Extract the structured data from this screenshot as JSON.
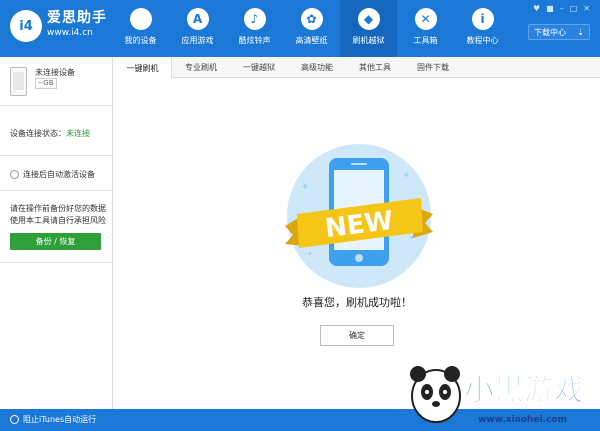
{
  "app": {
    "logo_text": "i4",
    "brand_name": "爱思助手",
    "brand_url": "www.i4.cn"
  },
  "nav": [
    {
      "label": "我的设备",
      "icon": "apple-icon",
      "glyph": ""
    },
    {
      "label": "应用游戏",
      "icon": "appstore-icon",
      "glyph": "A"
    },
    {
      "label": "酷炫铃声",
      "icon": "bell-icon",
      "glyph": "♪"
    },
    {
      "label": "高清壁纸",
      "icon": "flower-icon",
      "glyph": "✿"
    },
    {
      "label": "刷机越狱",
      "icon": "dropbox-icon",
      "glyph": "◆"
    },
    {
      "label": "工具箱",
      "icon": "tools-icon",
      "glyph": "✕"
    },
    {
      "label": "教程中心",
      "icon": "info-icon",
      "glyph": "i"
    }
  ],
  "window_controls": [
    "♥",
    "■",
    "–",
    "□",
    "✕"
  ],
  "download_center": {
    "label": "下载中心",
    "icon": "download-icon",
    "glyph": "⇣"
  },
  "sidebar": {
    "device_name": "未连接设备",
    "device_capacity": "--GB",
    "connection_label": "设备连接状态：",
    "connection_value": "未连接",
    "auto_activate": "连接后自动激活设备",
    "notice": "请在操作前备份好您的数据 使用本工具请自行承担风险",
    "backup_button": "备份 / 恢复"
  },
  "tabs": [
    "一键刷机",
    "专业刷机",
    "一键越狱",
    "高级功能",
    "其他工具",
    "固件下载"
  ],
  "main": {
    "badge_text": "NEW",
    "success_message": "恭喜您，刷机成功啦！",
    "confirm_button": "确定"
  },
  "footer": {
    "itunes_option": "阻止iTunes自动运行"
  },
  "watermark": {
    "text": "小黑游戏",
    "url": "www.xiaohei.com"
  },
  "colors": {
    "brand_blue": "#1b78d6",
    "active_nav": "#1467bd",
    "success_green": "#2e9f3a",
    "badge_circle": "#cfe8f9",
    "ribbon_yellow": "#f5c518"
  }
}
